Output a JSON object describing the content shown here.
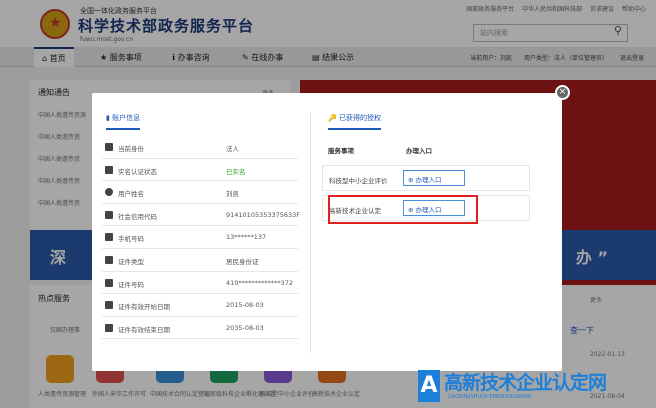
{
  "header": {
    "sub_title": "全国一体化政务服务平台",
    "main_title": "科学技术部政务服务平台",
    "url": "fuwu.most.gov.cn",
    "top_links": [
      "国家政务服务平台",
      "中华人民共和国科技部",
      "诉求建议",
      "帮助中心"
    ],
    "search_placeholder": "站内搜索"
  },
  "nav": {
    "items": [
      "首页",
      "服务事项",
      "办事咨询",
      "在线办事",
      "结果公示"
    ],
    "right": [
      "当前用户：刘凯",
      "用户类型：法人（单位管理员）",
      "退出登录"
    ]
  },
  "background": {
    "notice_title": "通知通告",
    "more": "更多",
    "notices": [
      "中国人类遗传资源",
      "中国人类遗传资",
      "中国人类遗传资",
      "中国人类遗传资",
      "中国人类遗传资"
    ],
    "banner_left": "深",
    "banner_right": "办 ”",
    "hot_title": "热点服务",
    "hot_search_placeholder": "仅聊办理事",
    "hot_labels": [
      "人类遗传资源管理",
      "外国人来华工作许可",
      "中国技术合同认定登记",
      "国家级科技企业孵化器认定",
      "科技型中小企业评价",
      "高新技术企业认定"
    ],
    "query_btn": "查一下",
    "dates": [
      "2022-01-13",
      "2021-08-04"
    ],
    "more2": "更多"
  },
  "modal": {
    "tab_account": "账户信息",
    "tab_services": "已获得的授权",
    "account_rows": [
      {
        "label": "当前身份",
        "value": "法人",
        "icon": "id-icon"
      },
      {
        "label": "实名认证状态",
        "value": "已实名",
        "icon": "verified-icon",
        "status": true
      },
      {
        "label": "用户姓名",
        "value": "刘凯",
        "icon": "user-icon"
      },
      {
        "label": "社会信用代码",
        "value": "91410105353375633F",
        "icon": "credit-code-icon"
      },
      {
        "label": "手机号码",
        "value": "13******137",
        "icon": "phone-icon"
      },
      {
        "label": "证件类型",
        "value": "居民身份证",
        "icon": "id-type-icon"
      },
      {
        "label": "证件号码",
        "value": "410*************372",
        "icon": "id-number-icon"
      },
      {
        "label": "证件有效开始日期",
        "value": "2015-08-03",
        "icon": "calendar-start-icon"
      },
      {
        "label": "证件有效结束日期",
        "value": "2035-08-03",
        "icon": "calendar-end-icon"
      }
    ],
    "service_head": "服务事项",
    "entry_head": "办理入口",
    "services": [
      {
        "name": "科技型中小企业评价",
        "entry": "办理入口"
      },
      {
        "name": "高新技术企业认定",
        "entry": "办理入口"
      }
    ],
    "close": "×"
  },
  "watermark": {
    "logo": "A",
    "text": "高新技术企业认定网",
    "sub": "GAOXINJISHUQIYERENDINGWANG"
  },
  "colors": {
    "brand_blue": "#1e3a78",
    "link_blue": "#1e5ab8",
    "highlight_red": "#e02020",
    "status_green": "#29a329"
  }
}
